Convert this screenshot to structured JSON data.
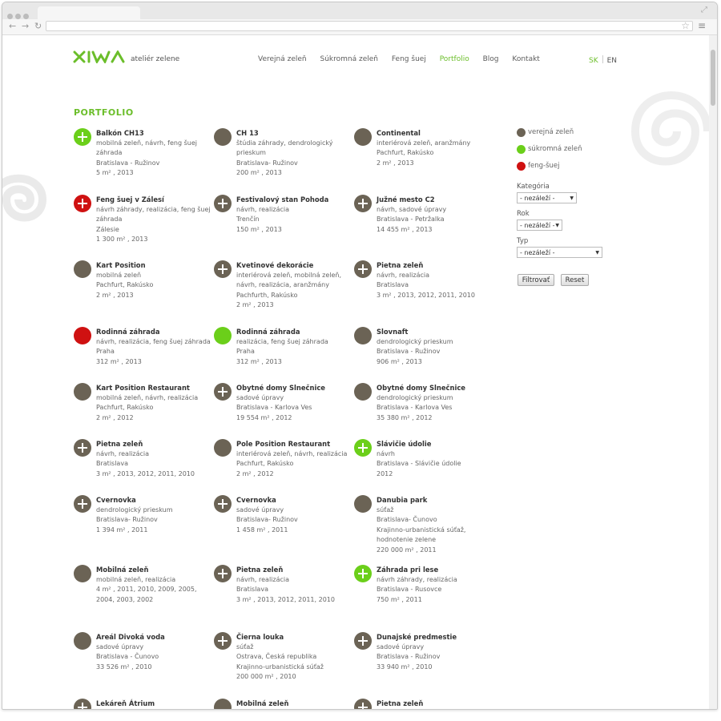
{
  "header": {
    "logo_text": "XIWA",
    "tagline": "ateliér zelene",
    "nav": [
      "Verejná zeleň",
      "Súkromná zeleň",
      "Feng šuej",
      "Portfolio",
      "Blog",
      "Kontakt"
    ],
    "active_nav": "Portfolio",
    "lang_sk": "SK",
    "lang_en": "EN"
  },
  "page_title": "PORTFOLIO",
  "colors": {
    "accent": "#6bbe2a",
    "public": "#6b6355",
    "private": "#6bcf1a",
    "feng": "#cf1111"
  },
  "items": [
    {
      "title": "Balkón CH13",
      "desc": "mobilná zeleň, návrh, feng šuej záhrada",
      "place": "Bratislava - Ružinov",
      "meta": "5 m² , 2013",
      "color": "private",
      "plus": true
    },
    {
      "title": "CH 13",
      "desc": "štúdia záhrady, dendrologický prieskum",
      "place": "Bratislava- Ružinov",
      "meta": "200 m² , 2013",
      "color": "public",
      "plus": false
    },
    {
      "title": "Continental",
      "desc": "interiérová zeleň, aranžmány",
      "place": "Pachfurt, Rakúsko",
      "meta": "2 m² , 2013",
      "color": "public",
      "plus": false
    },
    {
      "title": "Feng šuej v Zálesí",
      "desc": "návrh záhrady, realizácia, feng šuej záhrada",
      "place": "Zálesie",
      "meta": "1 300 m² , 2013",
      "color": "feng",
      "plus": true
    },
    {
      "title": "Festivalový stan Pohoda",
      "desc": "návrh, realizácia",
      "place": "Trenčín",
      "meta": "150 m² , 2013",
      "color": "public",
      "plus": true
    },
    {
      "title": "Južné mesto C2",
      "desc": "návrh, sadové úpravy",
      "place": "Bratislava - Petržalka",
      "meta": "14 455 m² , 2013",
      "color": "public",
      "plus": true
    },
    {
      "title": "Kart Position",
      "desc": "mobilná zeleň",
      "place": "Pachfurt, Rakúsko",
      "meta": "2 m² , 2013",
      "color": "public",
      "plus": false
    },
    {
      "title": "Kvetinové dekorácie",
      "desc": "interiérová zeleň, mobilná zeleň, návrh, realizácia, aranžmány",
      "place": "Pachfurth, Rakúsko",
      "meta": "2 m² , 2013",
      "color": "public",
      "plus": true
    },
    {
      "title": "Pietna zeleň",
      "desc": "návrh, realizácia",
      "place": "Bratislava",
      "meta": "3 m² , 2013, 2012, 2011, 2010",
      "color": "public",
      "plus": true
    },
    {
      "title": "Rodinná záhrada",
      "desc": "návrh, realizácia, feng šuej záhrada",
      "place": "Praha",
      "meta": "312 m² , 2013",
      "color": "feng",
      "plus": false
    },
    {
      "title": "Rodinná záhrada",
      "desc": "realizácia, feng šuej záhrada",
      "place": "Praha",
      "meta": "312 m² , 2013",
      "color": "private",
      "plus": false
    },
    {
      "title": "Slovnaft",
      "desc": "dendrologický prieskum",
      "place": "Bratislava - Ružinov",
      "meta": "906 m² , 2013",
      "color": "public",
      "plus": false
    },
    {
      "title": "Kart Position Restaurant",
      "desc": "mobilná zeleň, návrh, realizácia",
      "place": "Pachfurt, Rakúsko",
      "meta": "2 m² , 2012",
      "color": "public",
      "plus": false
    },
    {
      "title": "Obytné domy Slnečnice",
      "desc": "sadové úpravy",
      "place": "Bratislava - Karlova Ves",
      "meta": "19 554 m² , 2012",
      "color": "public",
      "plus": true
    },
    {
      "title": "Obytné domy Slnečnice",
      "desc": "dendrologický prieskum",
      "place": "Bratislava - Karlova Ves",
      "meta": "35 380 m² , 2012",
      "color": "public",
      "plus": false
    },
    {
      "title": "Pietna zeleň",
      "desc": "návrh, realizácia",
      "place": "Bratislava",
      "meta": "3 m² , 2013, 2012, 2011, 2010",
      "color": "public",
      "plus": true
    },
    {
      "title": "Pole Position Restaurant",
      "desc": "interiérová zeleň, návrh, realizácia",
      "place": "Pachfurt, Rakúsko",
      "meta": "2 m² , 2012",
      "color": "public",
      "plus": false
    },
    {
      "title": "Slávičie údolie",
      "desc": "návrh",
      "place": "Bratislava - Slávičie údolie",
      "meta": "2012",
      "color": "private",
      "plus": true
    },
    {
      "title": "Cvernovka",
      "desc": "dendrologický prieskum",
      "place": "Bratislava- Ružinov",
      "meta": "1 394 m² , 2011",
      "color": "public",
      "plus": true
    },
    {
      "title": "Cvernovka",
      "desc": "sadové úpravy",
      "place": "Bratislava- Ružinov",
      "meta": "1 458 m² , 2011",
      "color": "public",
      "plus": true
    },
    {
      "title": "Danubia park",
      "desc": "súťaž",
      "place": "Bratislava- Čunovo",
      "extra": "Krajinno-urbanistická súťaž, hodnotenie zelene",
      "meta": "220 000 m² , 2011",
      "color": "public",
      "plus": false
    },
    {
      "title": "Mobilná zeleň",
      "desc": "mobilná zeleň, realizácia",
      "place": "",
      "meta": "4 m² , 2011, 2010, 2009, 2005, 2004, 2003, 2002",
      "color": "public",
      "plus": false
    },
    {
      "title": "Pietna zeleň",
      "desc": "návrh, realizácia",
      "place": "Bratislava",
      "meta": "3 m² , 2013, 2012, 2011, 2010",
      "color": "public",
      "plus": true
    },
    {
      "title": "Záhrada pri lese",
      "desc": "návrh záhrady, realizácia",
      "place": "Bratislava - Rusovce",
      "meta": "750 m² , 2011",
      "color": "private",
      "plus": true
    },
    {
      "title": "Areál Divoká voda",
      "desc": "sadové úpravy",
      "place": "Bratislava - Čunovo",
      "meta": "33 526 m² , 2010",
      "color": "public",
      "plus": false
    },
    {
      "title": "Čierna louka",
      "desc": "súťaž",
      "place": "Ostrava, Česká republika",
      "extra": "Krajinno-urbanistická súťaž",
      "meta": "200 000 m² , 2010",
      "color": "public",
      "plus": true
    },
    {
      "title": "Dunajské predmestie",
      "desc": "sadové úpravy",
      "place": "Bratislava - Ružinov",
      "meta": "33 940 m² , 2010",
      "color": "public",
      "plus": true
    },
    {
      "title": "Lekáreň Átrium",
      "desc": "",
      "place": "",
      "meta": "",
      "color": "public",
      "plus": true
    },
    {
      "title": "Mobilná zeleň",
      "desc": "",
      "place": "",
      "meta": "",
      "color": "public",
      "plus": false
    },
    {
      "title": "Pietna zeleň",
      "desc": "",
      "place": "",
      "meta": "",
      "color": "public",
      "plus": true
    }
  ],
  "legend": [
    {
      "label": "verejná zeleň",
      "color": "#6b6355"
    },
    {
      "label": "súkromná zeleň",
      "color": "#6bcf1a"
    },
    {
      "label": "feng-šuej",
      "color": "#cf1111"
    }
  ],
  "filters": {
    "category_label": "Kategória",
    "category_value": "- nezáleží -",
    "year_label": "Rok",
    "year_value": "- nezáleží -",
    "type_label": "Typ",
    "type_value": "- nezáleží -",
    "filter_button": "Filtrovať",
    "reset_button": "Reset"
  }
}
